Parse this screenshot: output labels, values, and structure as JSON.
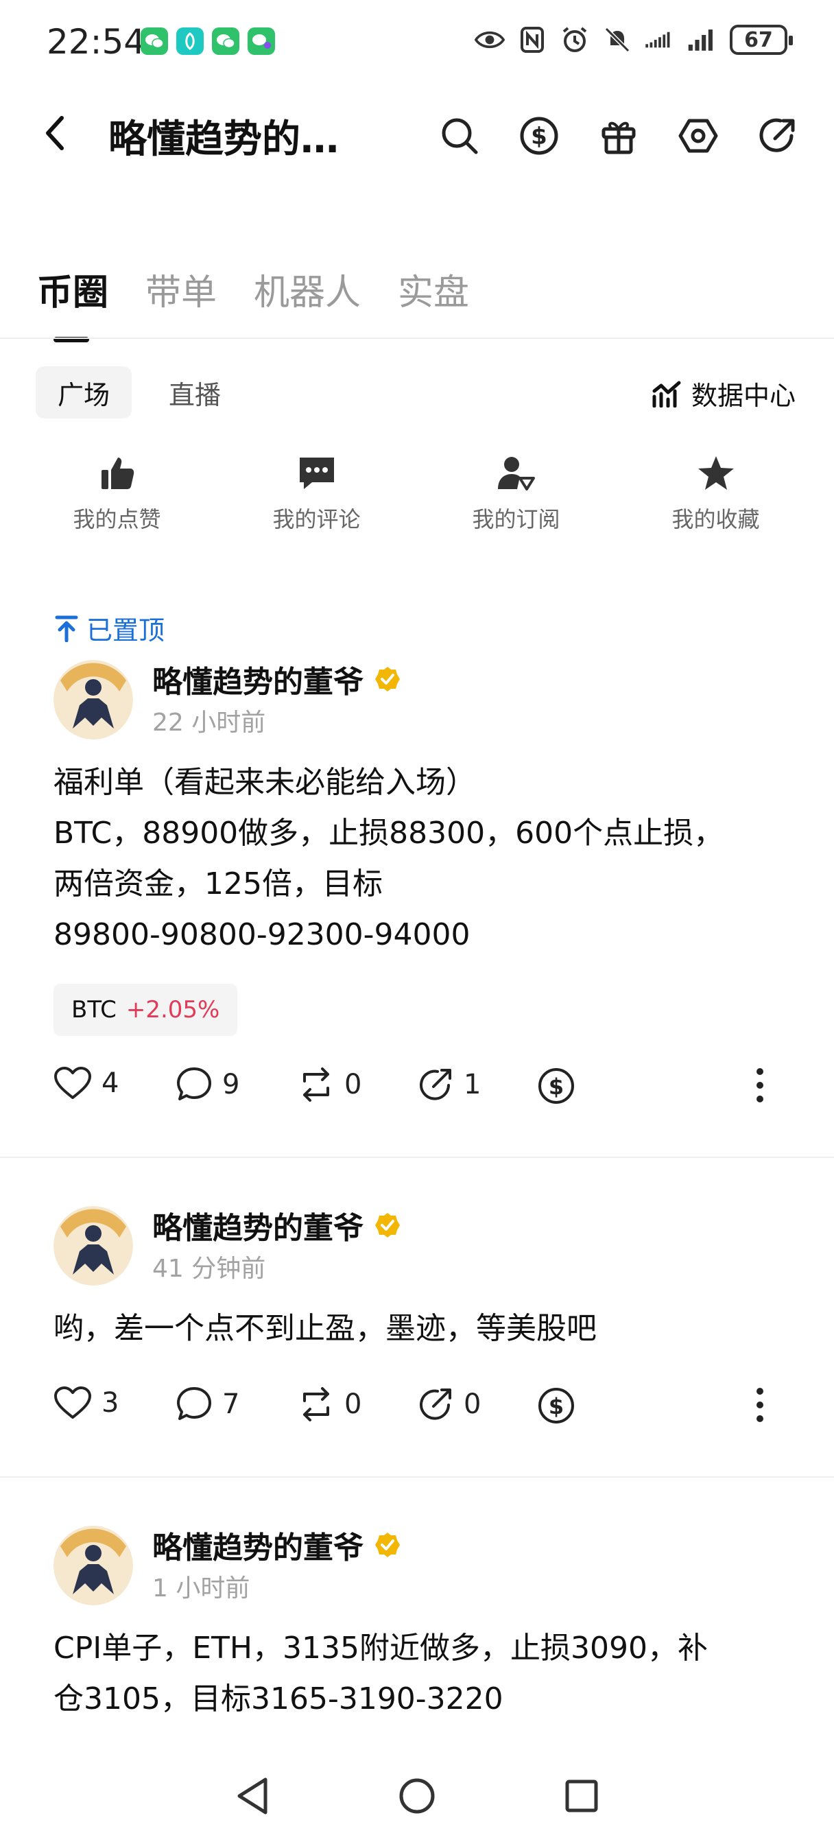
{
  "status_bar": {
    "time": "22:54",
    "battery": "67",
    "app_icons": [
      "wechat-icon",
      "soul-icon",
      "wechat-icon",
      "wechat-work-icon"
    ]
  },
  "header": {
    "title": "略懂趋势的…",
    "icons": [
      "search-icon",
      "dollar-circle-icon",
      "gift-icon",
      "settings-hex-icon",
      "share-icon"
    ]
  },
  "tabs": [
    {
      "label": "币圈",
      "active": true
    },
    {
      "label": "带单",
      "active": false
    },
    {
      "label": "机器人",
      "active": false
    },
    {
      "label": "实盘",
      "active": false
    }
  ],
  "subtabs": [
    {
      "label": "广场",
      "active": true
    },
    {
      "label": "直播",
      "active": false
    }
  ],
  "data_center": "数据中心",
  "quick_actions": [
    {
      "label": "我的点赞",
      "icon": "thumbs-up-icon"
    },
    {
      "label": "我的评论",
      "icon": "comment-icon"
    },
    {
      "label": "我的订阅",
      "icon": "subscribe-icon"
    },
    {
      "label": "我的收藏",
      "icon": "star-icon"
    }
  ],
  "pinned_label": "已置顶",
  "posts": [
    {
      "author": "略懂趋势的董爷",
      "time": "22 小时前",
      "lines": [
        "福利单（看起来未必能给入场）",
        "BTC，88900做多，止损88300，600个点止损，",
        "两倍资金，125倍，目标",
        "89800-90800-92300-94000"
      ],
      "tag": {
        "symbol": "BTC",
        "change": "+2.05%"
      },
      "likes": "4",
      "comments": "9",
      "reposts": "0",
      "shares": "1"
    },
    {
      "author": "略懂趋势的董爷",
      "time": "41 分钟前",
      "lines": [
        "哟，差一个点不到止盈，墨迹，等美股吧"
      ],
      "likes": "3",
      "comments": "7",
      "reposts": "0",
      "shares": "0"
    },
    {
      "author": "略懂趋势的董爷",
      "time": "1 小时前",
      "lines": [
        "CPI单子，ETH，3135附近做多，止损3090，补",
        "仓3105，目标3165-3190-3220"
      ]
    }
  ],
  "colors": {
    "accent_blue": "#1b6fd8",
    "positive_red": "#e23b5a",
    "verified_gold": "#f2b705"
  }
}
